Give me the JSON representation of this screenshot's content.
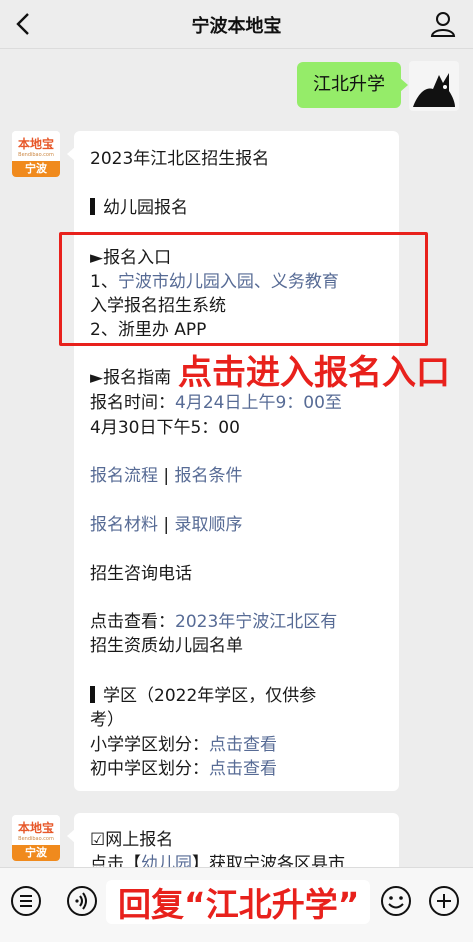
{
  "header": {
    "title": "宁波本地宝"
  },
  "my_message": {
    "text": "江北升学"
  },
  "bot_avatar": {
    "brand": "本地宝",
    "sub": "Bendibao.com",
    "city": "宁波"
  },
  "card1": {
    "title": "2023年江北区招生报名",
    "section1": "幼儿园报名",
    "entry_heading": "►报名入口",
    "entry1_prefix": "1、",
    "entry1_link_line1": "宁波市幼儿园入园、义务教育",
    "entry1_link_line2": "入学报名招生系统",
    "entry2": "2、浙里办 APP",
    "guide_heading": "►报名指南",
    "time_label": "报名时间：",
    "time_value_line1": "4月24日上午9：00至",
    "time_value_line2": "4月30日下午5：00",
    "link_process": "报名流程",
    "link_conditions": "报名条件",
    "link_materials": "报名材料",
    "link_order": "录取顺序",
    "link_phone": "招生咨询电话",
    "view_label": "点击查看：",
    "view_link_line1": "2023年宁波江北区有",
    "view_link_line2": "招生资质幼儿园名单",
    "section2_line1": "学区（2022年学区，仅供参",
    "section2_line2": "考）",
    "primary_label": "小学学区划分：",
    "primary_link": "点击查看",
    "middle_label": "初中学区划分：",
    "middle_link": "点击查看",
    "separator": "|"
  },
  "card2": {
    "line1": "☑网上报名",
    "line2_prefix": "点击【",
    "line2_link": "幼儿园",
    "line2_suffix": "】获取宁波各区县市"
  },
  "annotations": {
    "enter": "点击进入报名入口",
    "reply": "回复“江北升学”"
  },
  "colors": {
    "accent_red": "#e8211c",
    "link": "#576b95",
    "bubble_green": "#95ec69"
  }
}
